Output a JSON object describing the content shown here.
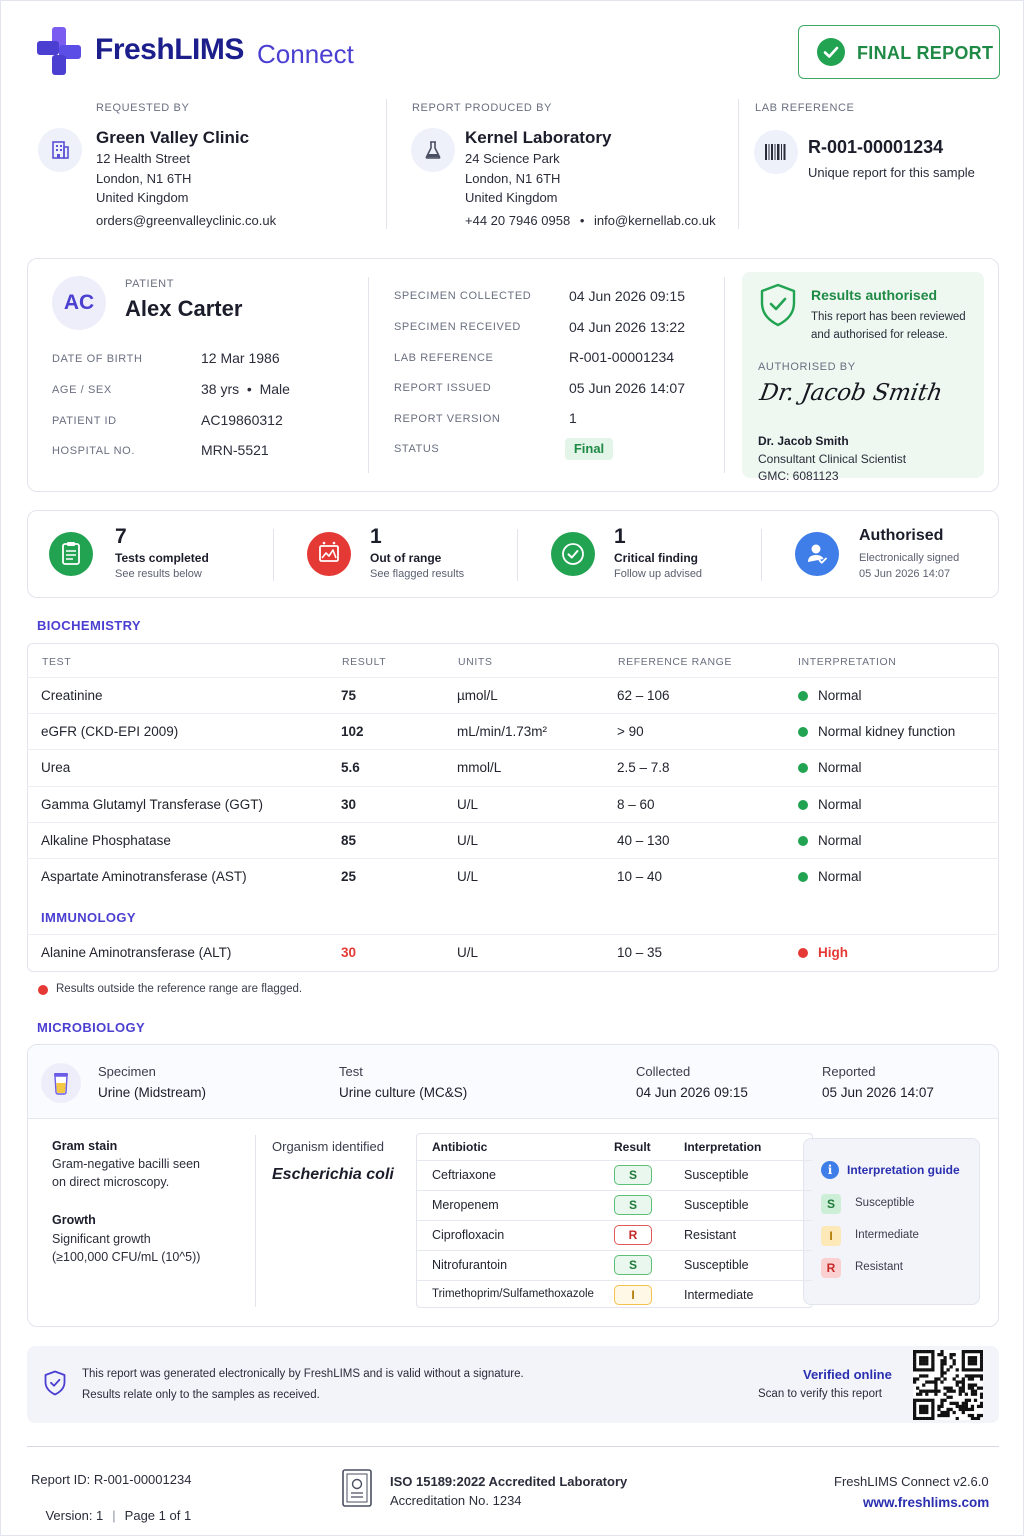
{
  "brand": {
    "name": "FreshLIMS",
    "product": "Connect"
  },
  "report_badge": "FINAL REPORT",
  "requested_by": {
    "label": "REQUESTED BY",
    "name": "Green Valley Clinic",
    "line1": "12 Health Street",
    "line2": "London, N1 6TH",
    "line3": "United Kingdom",
    "email": "orders@greenvalleyclinic.co.uk"
  },
  "produced_by": {
    "label": "REPORT PRODUCED BY",
    "name": "Kernel Laboratory",
    "line1": "24 Science Park",
    "line2": "London, N1 6TH",
    "line3": "United Kingdom",
    "phone": "+44 20 7946 0958",
    "sep": "•",
    "email": "info@kernellab.co.uk"
  },
  "lab_reference": {
    "label": "LAB REFERENCE",
    "value": "R-001-00001234",
    "note": "Unique report for this sample"
  },
  "patient": {
    "initials": "AC",
    "label": "PATIENT",
    "name": "Alex Carter",
    "fields": [
      {
        "label": "DATE OF BIRTH",
        "value": "12 Mar 1986"
      },
      {
        "label": "AGE / SEX",
        "value": "38 yrs  •  Male"
      },
      {
        "label": "PATIENT ID",
        "value": "AC19860312"
      },
      {
        "label": "HOSPITAL NO.",
        "value": "MRN-5521"
      }
    ]
  },
  "specimen": {
    "fields": [
      {
        "label": "SPECIMEN COLLECTED",
        "value": "04 Jun 2026 09:15"
      },
      {
        "label": "SPECIMEN RECEIVED",
        "value": "04 Jun 2026 13:22"
      },
      {
        "label": "LAB REFERENCE",
        "value": "R-001-00001234"
      },
      {
        "label": "REPORT ISSUED",
        "value": "05 Jun 2026 14:07"
      },
      {
        "label": "REPORT VERSION",
        "value": "1"
      }
    ],
    "status_label": "STATUS",
    "status_value": "Final"
  },
  "authorisation": {
    "title": "Results authorised",
    "desc1": "This report has been reviewed",
    "desc2": "and authorised for release.",
    "by_label": "AUTHORISED BY",
    "signature": "Dr. Jacob Smith",
    "name": "Dr. Jacob Smith",
    "role": "Consultant Clinical Scientist",
    "gmc": "GMC: 6081123"
  },
  "summary": [
    {
      "value": "7",
      "title": "Tests completed",
      "sub": "See results below",
      "color": "#22a352"
    },
    {
      "value": "1",
      "title": "Out of range",
      "sub": "See flagged results",
      "color": "#e53935"
    },
    {
      "value": "1",
      "title": "Critical finding",
      "sub": "Follow up advised",
      "color": "#22a352"
    },
    {
      "value": "",
      "title": "Authorised",
      "sub": "Electronically signed",
      "sub2": "05 Jun 2026 14:07",
      "color": "#3f7ee8"
    }
  ],
  "biochem": {
    "section": "BIOCHEMISTRY",
    "headers": [
      "TEST",
      "RESULT",
      "UNITS",
      "REFERENCE RANGE",
      "INTERPRETATION"
    ],
    "rows": [
      {
        "test": "Creatinine",
        "result": "75",
        "units": "µmol/L",
        "range": "62 – 106",
        "interp": "Normal",
        "flag": false
      },
      {
        "test": "eGFR (CKD-EPI 2009)",
        "result": "102",
        "units": "mL/min/1.73m²",
        "range": "> 90",
        "interp": "Normal kidney function",
        "flag": false
      },
      {
        "test": "Urea",
        "result": "5.6",
        "units": "mmol/L",
        "range": "2.5 – 7.8",
        "interp": "Normal",
        "flag": false
      },
      {
        "test": "Gamma Glutamyl Transferase (GGT)",
        "result": "30",
        "units": "U/L",
        "range": "8 – 60",
        "interp": "Normal",
        "flag": false
      },
      {
        "test": "Alkaline Phosphatase",
        "result": "85",
        "units": "U/L",
        "range": "40 – 130",
        "interp": "Normal",
        "flag": false
      },
      {
        "test": "Aspartate Aminotransferase (AST)",
        "result": "25",
        "units": "U/L",
        "range": "10 – 40",
        "interp": "Normal",
        "flag": false
      }
    ],
    "immuno_section": "IMMUNOLOGY",
    "immuno_rows": [
      {
        "test": "Alanine Aminotransferase (ALT)",
        "result": "30",
        "units": "U/L",
        "range": "10 – 35",
        "interp": "High",
        "flag": true
      }
    ],
    "flag_note": "Results outside the reference range are flagged."
  },
  "micro": {
    "section": "MICROBIOLOGY",
    "specimen_label": "Specimen",
    "specimen_value": "Urine (Midstream)",
    "test_label": "Test",
    "test_value": "Urine culture (MC&S)",
    "collected_label": "Collected",
    "collected_value": "04 Jun 2026 09:15",
    "reported_label": "Reported",
    "reported_value": "05 Jun 2026 14:07",
    "gram_title": "Gram stain",
    "gram_1": "Gram-negative bacilli seen",
    "gram_2": "on direct microscopy.",
    "growth_title": "Growth",
    "growth_1": "Significant growth",
    "growth_2": "(≥100,000 CFU/mL (10^5))",
    "organism_label": "Organism identified",
    "organism": "Escherichia coli",
    "abx_headers": [
      "Antibiotic",
      "Result",
      "Interpretation"
    ],
    "abx": [
      {
        "name": "Ceftriaxone",
        "code": "S",
        "interp": "Susceptible"
      },
      {
        "name": "Meropenem",
        "code": "S",
        "interp": "Susceptible"
      },
      {
        "name": "Ciprofloxacin",
        "code": "R",
        "interp": "Resistant"
      },
      {
        "name": "Nitrofurantoin",
        "code": "S",
        "interp": "Susceptible"
      },
      {
        "name": "Trimethoprim/Sulfamethoxazole",
        "code": "I",
        "interp": "Intermediate"
      }
    ],
    "guide_title": "Interpretation guide",
    "guide": [
      {
        "code": "S",
        "label": "Susceptible"
      },
      {
        "code": "I",
        "label": "Intermediate"
      },
      {
        "code": "R",
        "label": "Resistant"
      }
    ]
  },
  "notice": {
    "line1": "This report was generated electronically by FreshLIMS and is valid without a signature.",
    "line2": "Results relate only to the samples as received.",
    "verify_title": "Verified online",
    "verify_sub": "Scan to verify this report"
  },
  "footer": {
    "report_id": "Report ID: R-001-00001234",
    "version": "Version: 1",
    "sep": "|",
    "page": "Page 1 of 1",
    "accred_title": "ISO 15189:2022 Accredited Laboratory",
    "accred_no": "Accreditation No. 1234",
    "app_version": "FreshLIMS Connect v2.6.0",
    "website": "www.freshlims.com"
  }
}
